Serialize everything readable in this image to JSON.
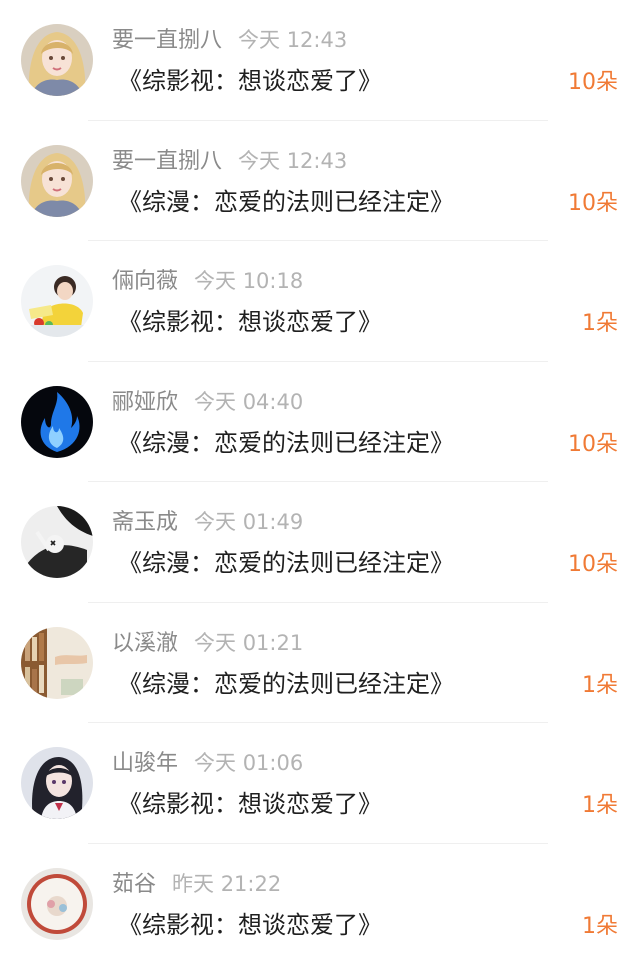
{
  "gift_list": [
    {
      "name": "要一直捌八",
      "time": "今天 12:43",
      "title": "《综影视：想谈恋爱了》",
      "count": "10朵",
      "avatar": "anime-girl-blonde-icon"
    },
    {
      "name": "要一直捌八",
      "time": "今天 12:43",
      "title": "《综漫：恋爱的法则已经注定》",
      "count": "10朵",
      "avatar": "anime-girl-blonde-icon"
    },
    {
      "name": "倆向薇",
      "time": "今天 10:18",
      "title": "《综影视：想谈恋爱了》",
      "count": "1朵",
      "avatar": "boy-yellow-shirt-icon"
    },
    {
      "name": "郦娅欣",
      "time": "今天 04:40",
      "title": "《综漫：恋爱的法则已经注定》",
      "count": "10朵",
      "avatar": "blue-flame-icon"
    },
    {
      "name": "斋玉成",
      "time": "今天 01:49",
      "title": "《综漫：恋爱的法则已经注定》",
      "count": "10朵",
      "avatar": "anime-figure-dark-icon"
    },
    {
      "name": "以溪澈",
      "time": "今天 01:21",
      "title": "《综漫：恋爱的法则已经注定》",
      "count": "1朵",
      "avatar": "bookshelf-photo-icon"
    },
    {
      "name": "山骏年",
      "time": "今天 01:06",
      "title": "《综影视：想谈恋爱了》",
      "count": "1朵",
      "avatar": "anime-girl-dark-hair-icon"
    },
    {
      "name": "茹谷",
      "time": "昨天 21:22",
      "title": "《综影视：想谈恋爱了》",
      "count": "1朵",
      "avatar": "bowl-photo-icon"
    }
  ],
  "colors": {
    "count": "#f07a35",
    "name": "#8a8a8a",
    "time": "#b3b3b3",
    "title": "#1f1f1f"
  }
}
